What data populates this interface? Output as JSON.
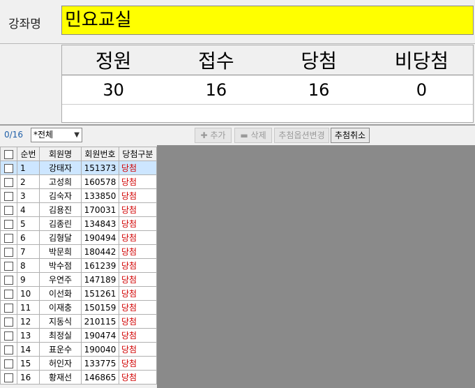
{
  "course": {
    "label": "강좌명",
    "name": "민요교실"
  },
  "stats": {
    "headers": [
      "정원",
      "접수",
      "당첨",
      "비당첨"
    ],
    "values": [
      "30",
      "16",
      "16",
      "0"
    ]
  },
  "toolbar": {
    "count": "0/16",
    "filter_value": "*전체",
    "add_label": "추가",
    "delete_label": "삭제",
    "change_option_label": "추첨옵션변경",
    "cancel_draw_label": "추첨취소"
  },
  "table": {
    "columns": [
      "순번",
      "회원명",
      "회원번호",
      "당첨구분"
    ],
    "rows": [
      {
        "no": "1",
        "name": "강태자",
        "num": "151373",
        "result": "당첨"
      },
      {
        "no": "2",
        "name": "고성희",
        "num": "160578",
        "result": "당첨"
      },
      {
        "no": "3",
        "name": "김숙자",
        "num": "133850",
        "result": "당첨"
      },
      {
        "no": "4",
        "name": "김용진",
        "num": "170031",
        "result": "당첨"
      },
      {
        "no": "5",
        "name": "김종린",
        "num": "134843",
        "result": "당첨"
      },
      {
        "no": "6",
        "name": "김형달",
        "num": "190494",
        "result": "당첨"
      },
      {
        "no": "7",
        "name": "박문희",
        "num": "180442",
        "result": "당첨"
      },
      {
        "no": "8",
        "name": "박수점",
        "num": "161239",
        "result": "당첨"
      },
      {
        "no": "9",
        "name": "우연주",
        "num": "147189",
        "result": "당첨"
      },
      {
        "no": "10",
        "name": "이선화",
        "num": "151261",
        "result": "당첨"
      },
      {
        "no": "11",
        "name": "이재충",
        "num": "150159",
        "result": "당첨"
      },
      {
        "no": "12",
        "name": "지동식",
        "num": "210115",
        "result": "당첨"
      },
      {
        "no": "13",
        "name": "최정실",
        "num": "190474",
        "result": "당첨"
      },
      {
        "no": "14",
        "name": "표운수",
        "num": "190040",
        "result": "당첨"
      },
      {
        "no": "15",
        "name": "허인자",
        "num": "133775",
        "result": "당첨"
      },
      {
        "no": "16",
        "name": "황재선",
        "num": "146865",
        "result": "당첨"
      }
    ]
  },
  "colors": {
    "course_field": "#ffff00",
    "result_text": "#d00000",
    "selected_row": "#cde6ff"
  }
}
